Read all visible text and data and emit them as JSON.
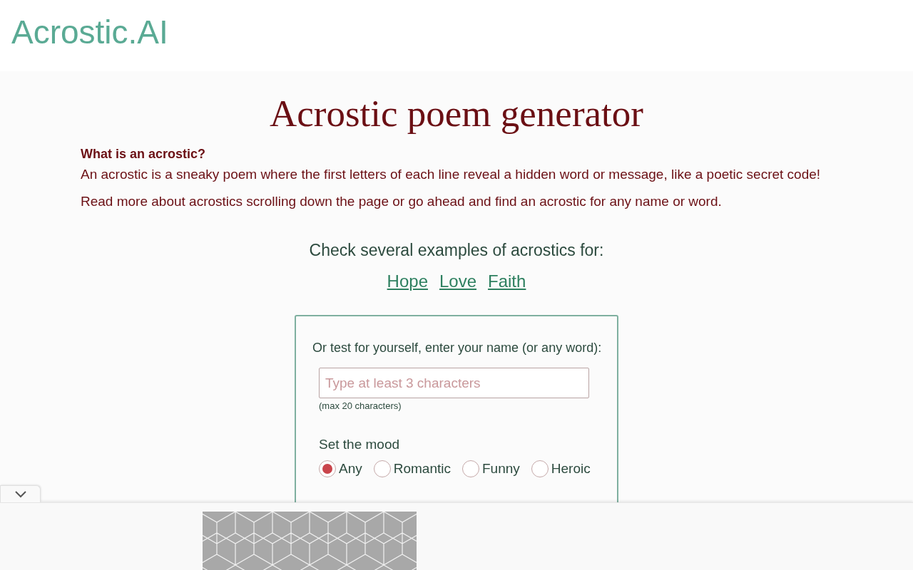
{
  "header": {
    "logo": "Acrostic.AI"
  },
  "title": "Acrostic poem generator",
  "intro": {
    "heading": "What is an acrostic?",
    "paragraphs": [
      "An acrostic is a sneaky poem where the first letters of each line reveal a hidden word or message, like a poetic secret code!",
      "Read more about acrostics scrolling down the page or go ahead and find an acrostic for any name or word."
    ]
  },
  "examples": {
    "prompt": "Check several examples of acrostics for:",
    "links": [
      "Hope",
      "Love",
      "Faith"
    ]
  },
  "form": {
    "label": "Or test for yourself, enter your name (or any word):",
    "placeholder": "Type at least 3 characters",
    "hint": "(max 20 characters)",
    "mood": {
      "label": "Set the mood",
      "options": [
        {
          "label": "Any",
          "selected": true
        },
        {
          "label": "Romantic",
          "selected": false
        },
        {
          "label": "Funny",
          "selected": false
        },
        {
          "label": "Heroic",
          "selected": false
        }
      ]
    }
  }
}
